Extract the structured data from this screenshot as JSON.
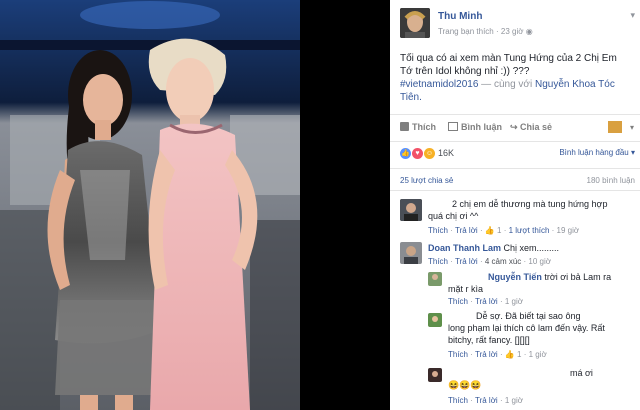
{
  "post": {
    "author": "Thu Minh",
    "subtitle": "Trang bạn thích",
    "time": "23 giờ",
    "text_lines": [
      "Tối qua có ai xem màn Tung Hứng của 2 Chị Em",
      "Tớ trên Idol không nhỉ :)) ???",
      "#vietnamidol2016",
      "Tiên."
    ],
    "hashtag": "#vietnamidol2016",
    "with_text": " — cùng với ",
    "tagged": "Nguyễn Khoa Tóc"
  },
  "actions": {
    "like": "Thích",
    "comment": "Bình luận",
    "share": "Chia sẻ"
  },
  "reactions": {
    "count": "16K",
    "sort_label": "Bình luận hàng đầu"
  },
  "stats": {
    "shares": "25 lượt chia sẻ",
    "comments": "180 bình luận"
  },
  "comments": [
    {
      "text_line1": "2 chị em dễ thương mà tung hứng hợp",
      "text_line2": "quá chị ơi ^^",
      "like": "Thích",
      "reply": "Trả lời",
      "likes": "1",
      "replies": "1 lượt thích",
      "time": "19 giờ"
    },
    {
      "author": "Doan Thanh Lam",
      "text": "Chị xem.........",
      "like": "Thích",
      "reply": "Trả lời",
      "reactions": "4 cảm xúc",
      "time": "10 giờ"
    }
  ],
  "replies": [
    {
      "author": "Nguyễn Tiến",
      "text_line1": "trời ơi bả Lam ra",
      "text_line2": "mặt r kìa",
      "like": "Thích",
      "reply": "Trả lời",
      "time": "1 giờ"
    },
    {
      "text_line1": "Dễ sợ. Đã biết tại sao ông",
      "text_line2": "long phạm lại thích cô lam đến vậy. Rất",
      "text_line3": "bitchy, rất fancy. [][][]",
      "like": "Thích",
      "reply": "Trả lời",
      "likes": "1",
      "time": "1 giờ"
    },
    {
      "text_line1": "má ơi",
      "emoji": "😆😆😆",
      "like": "Thích",
      "reply": "Trả lời",
      "time": "1 giờ"
    }
  ],
  "colors": {
    "link": "#365899",
    "muted": "#90949c",
    "like_blue": "#5890ff",
    "love_red": "#f25268",
    "haha_yellow": "#f7b125"
  }
}
